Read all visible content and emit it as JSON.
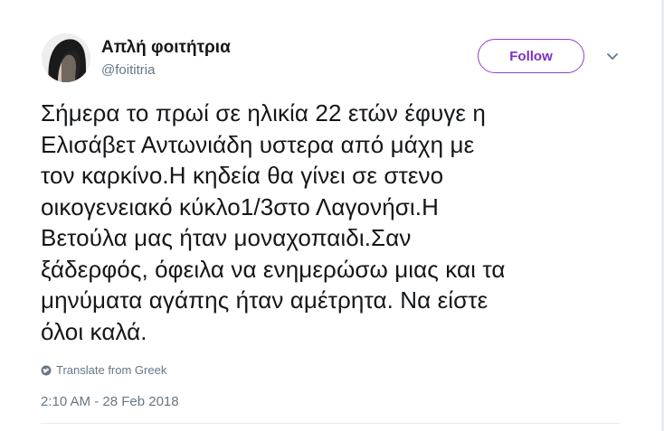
{
  "tweet": {
    "display_name": "Απλή φοιτήτρια",
    "username": "@foititria",
    "follow_label": "Follow",
    "text_lines": [
      "Σήμερα το πρωί σε ηλικία 22 ετών έφυγε η",
      "Ελισάβετ Αντωνιάδη υστερα από μάχη με",
      "τον καρκίνο.Η κηδεία θα γίνει σε στενο",
      "οικογενειακό κύκλο1/3στο Λαγονήσι.Η",
      "Βετούλα μας ήταν μοναχοπαιδι.Σαν",
      "ξάδερφός, όφειλα να ενημερώσω μιας και τα",
      "μηνύματα αγάπης ήταν αμέτρητα. Να είστε",
      "όλοι καλά."
    ],
    "translate_label": "Translate from Greek",
    "timestamp": "2:10 AM - 28 Feb 2018"
  },
  "icons": {
    "caret": "chevron-down-icon",
    "translate": "globe-icon"
  },
  "colors": {
    "follow_accent": "#7b2fbf",
    "secondary_text": "#657786",
    "primary_text": "#14171a"
  }
}
